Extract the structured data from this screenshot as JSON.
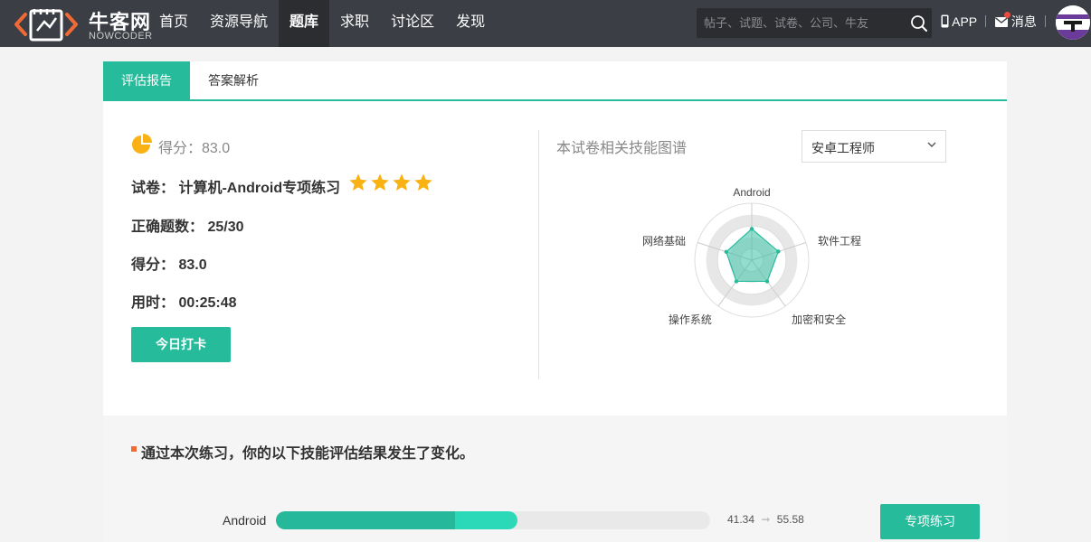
{
  "header": {
    "logo_text": "牛客网",
    "logo_sub": "NOWCODER",
    "nav": [
      {
        "label": "首页"
      },
      {
        "label": "资源导航"
      },
      {
        "label": "题库",
        "active": true
      },
      {
        "label": "求职"
      },
      {
        "label": "讨论区"
      },
      {
        "label": "发现"
      }
    ],
    "search_placeholder": "帖子、试题、试卷、公司、牛友",
    "app_label": "APP",
    "messages_label": "消息",
    "icons": [
      "logo-icon",
      "search-icon",
      "phone-icon",
      "mail-icon",
      "avatar"
    ]
  },
  "tabs": [
    "评估报告",
    "答案解析"
  ],
  "report": {
    "score_head": "得分：83.0",
    "paper_label": "试卷：",
    "paper_name": "计算机-Android专项练习",
    "stars": 4,
    "correct_label": "正确题数：",
    "correct_value": "25/30",
    "score_label": "得分：",
    "score_value": "83.0",
    "time_label": "用时：",
    "time_value": "00:25:48",
    "checkin_button": "今日打卡"
  },
  "skills": {
    "title": "本试卷相关技能图谱",
    "selected_role": "安卓工程师",
    "radar": {
      "axes": [
        "Android",
        "软件工程",
        "加密和安全",
        "操作系统",
        "网络基础"
      ],
      "values": [
        0.55,
        0.49,
        0.46,
        0.46,
        0.47
      ]
    }
  },
  "change": {
    "title": "通过本次练习，你的以下技能评估结果发生了变化。",
    "items": [
      {
        "skill": "Android",
        "before": "41.34",
        "after": "55.58",
        "before_fraction": 0.413,
        "after_fraction": 0.556
      }
    ],
    "practice_button": "专项练习"
  },
  "colors": {
    "accent": "#25bb9b",
    "topbar": "#3b3e44",
    "star": "#f9b114",
    "section_mark": "#f06a35"
  }
}
